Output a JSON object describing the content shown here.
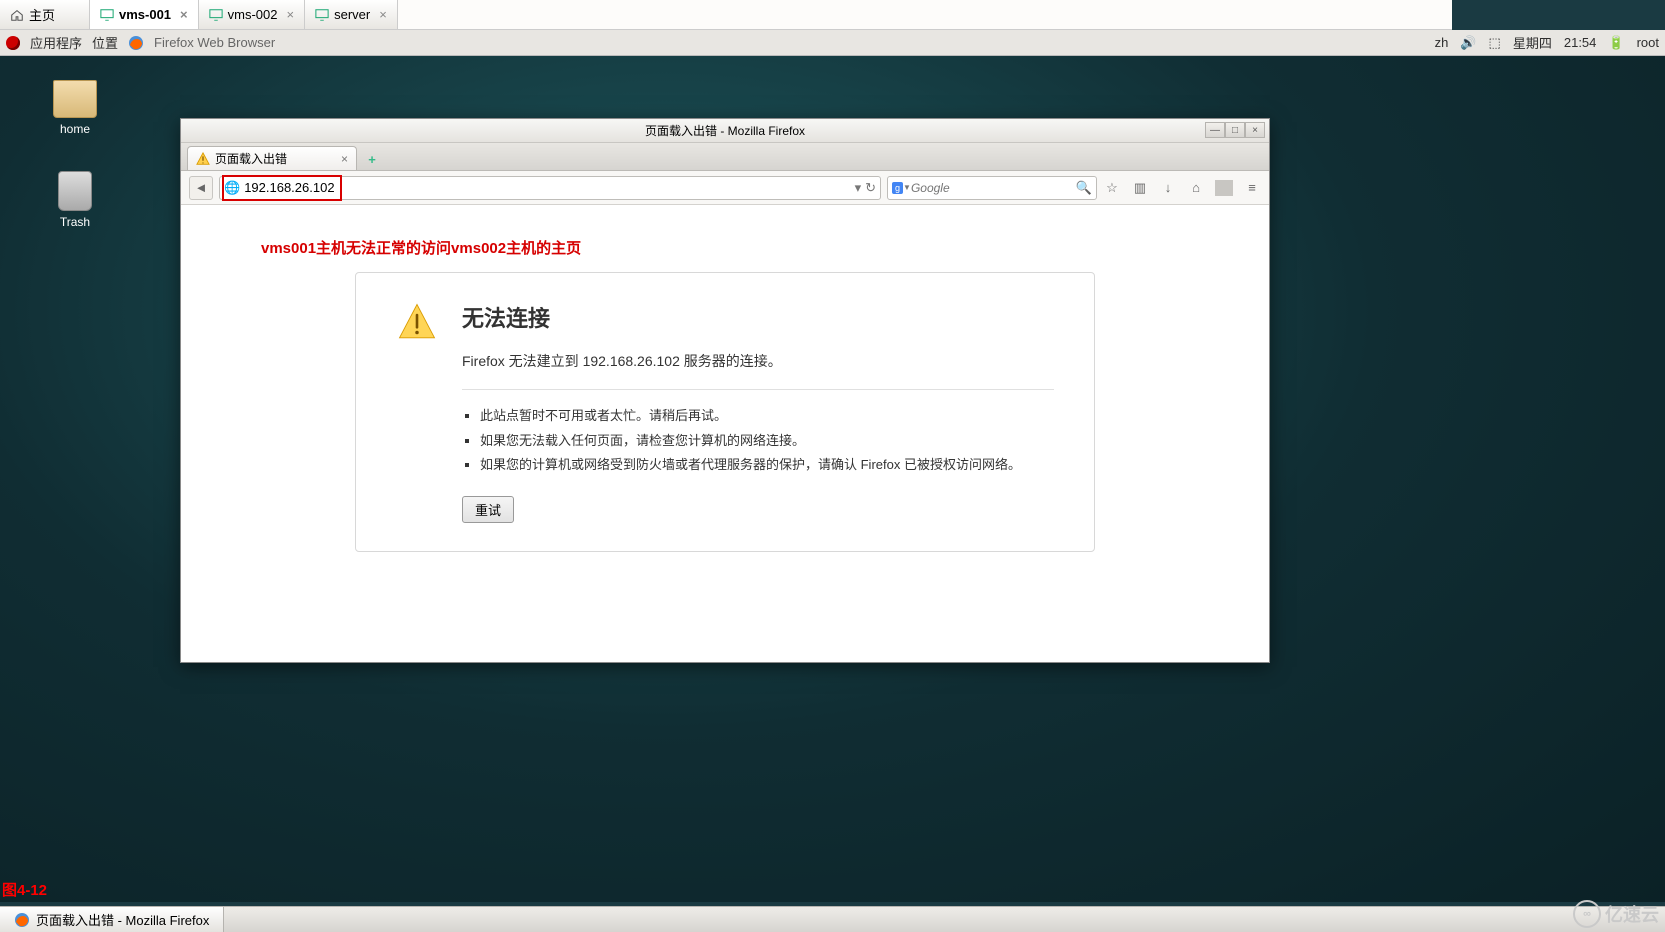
{
  "host_tabs": [
    {
      "label": "主页",
      "active": false
    },
    {
      "label": "vms-001",
      "active": true
    },
    {
      "label": "vms-002",
      "active": false
    },
    {
      "label": "server",
      "active": false
    }
  ],
  "gnome": {
    "apps": "应用程序",
    "places": "位置",
    "app_title": "Firefox Web Browser",
    "lang": "zh",
    "day": "星期四",
    "time": "21:54",
    "user": "root"
  },
  "desktop_icons": {
    "home": "home",
    "trash": "Trash"
  },
  "window": {
    "title": "页面载入出错  -  Mozilla Firefox"
  },
  "fftab": {
    "label": "页面载入出错"
  },
  "nav": {
    "url": "192.168.26.102",
    "search_placeholder": "Google"
  },
  "annotation": "vms001主机无法正常的访问vms002主机的主页",
  "error": {
    "heading": "无法连接",
    "message": "Firefox 无法建立到 192.168.26.102 服务器的连接。",
    "items": [
      "此站点暂时不可用或者太忙。请稍后再试。",
      "如果您无法载入任何页面，请检查您计算机的网络连接。",
      "如果您的计算机或网络受到防火墙或者代理服务器的保护，请确认 Firefox 已被授权访问网络。"
    ],
    "retry": "重试"
  },
  "caption": "图4-12",
  "taskbar_item": "页面载入出错 - Mozilla Firefox",
  "watermark": "亿速云"
}
